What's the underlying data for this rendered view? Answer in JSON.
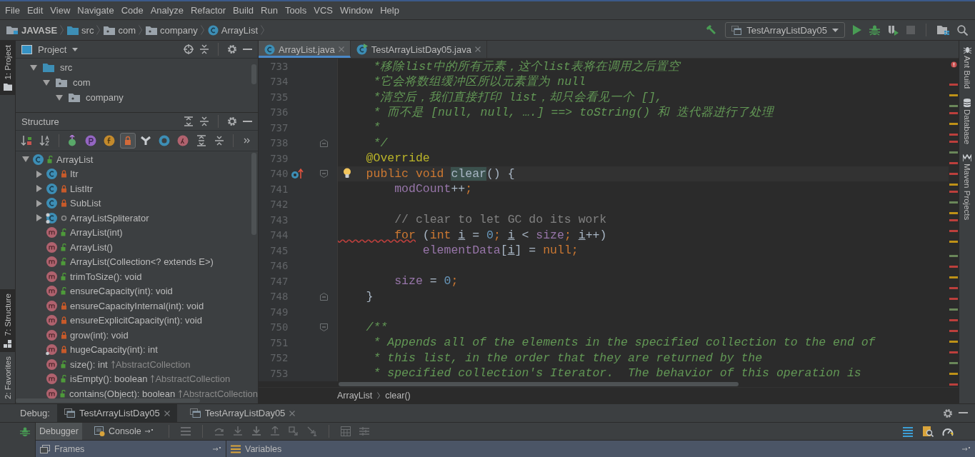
{
  "menu": [
    "File",
    "Edit",
    "View",
    "Navigate",
    "Code",
    "Analyze",
    "Refactor",
    "Build",
    "Run",
    "Tools",
    "VCS",
    "Window",
    "Help"
  ],
  "breadcrumbs": [
    {
      "label": "JAVASE",
      "kind": "project"
    },
    {
      "label": "src",
      "kind": "source-folder"
    },
    {
      "label": "com",
      "kind": "package"
    },
    {
      "label": "company",
      "kind": "package"
    },
    {
      "label": "ArrayList",
      "kind": "class"
    }
  ],
  "run_config": "TestArrayListDay05",
  "left_stripe": [
    {
      "label": "1: Project",
      "selected": true
    },
    {
      "label": "7: Structure",
      "selected": true
    },
    {
      "label": "2: Favorites",
      "selected": false
    }
  ],
  "right_stripe": [
    "Ant Build",
    "Database",
    "Maven Projects"
  ],
  "project_panel": {
    "title": "Project",
    "tree": [
      {
        "label": "src",
        "kind": "source-folder",
        "expanded": true,
        "children": [
          {
            "label": "com",
            "kind": "package",
            "expanded": true,
            "children": [
              {
                "label": "company",
                "kind": "package",
                "expanded": true
              }
            ]
          }
        ]
      }
    ]
  },
  "structure_panel": {
    "title": "Structure",
    "toolbar": [
      {
        "kind": "sort-visibility",
        "selected": false
      },
      {
        "kind": "sort-alpha",
        "selected": false
      },
      {
        "kind": "inherited",
        "selected": false
      },
      {
        "kind": "properties",
        "selected": false
      },
      {
        "kind": "fields",
        "selected": false
      },
      {
        "kind": "non-public",
        "selected": true
      },
      {
        "kind": "anonymous",
        "selected": false
      },
      {
        "kind": "ring",
        "selected": false
      },
      {
        "kind": "lambdas",
        "selected": false
      },
      {
        "kind": "expand-all",
        "selected": false
      },
      {
        "kind": "collapse-all",
        "selected": false
      },
      {
        "kind": "more",
        "selected": false
      }
    ],
    "tree": [
      {
        "label": "ArrayList",
        "kind": "public-class",
        "expanded": true,
        "children": [
          {
            "label": "Itr",
            "kind": "private-class",
            "expanded": false
          },
          {
            "label": "ListItr",
            "kind": "private-class",
            "expanded": false
          },
          {
            "label": "SubList",
            "kind": "private-class",
            "expanded": false
          },
          {
            "label": "ArrayListSpliterator",
            "kind": "package-static-class",
            "expanded": false
          },
          {
            "label": "ArrayList(int)",
            "kind": "public-method"
          },
          {
            "label": "ArrayList()",
            "kind": "public-method"
          },
          {
            "label": "ArrayList(Collection<? extends E>)",
            "kind": "public-method"
          },
          {
            "label": "trimToSize(): void",
            "kind": "public-method"
          },
          {
            "label": "ensureCapacity(int): void",
            "kind": "public-method"
          },
          {
            "label": "ensureCapacityInternal(int): void",
            "kind": "private-method"
          },
          {
            "label": "ensureExplicitCapacity(int): void",
            "kind": "private-method"
          },
          {
            "label": "grow(int): void",
            "kind": "private-method"
          },
          {
            "label": "hugeCapacity(int): int",
            "kind": "private-static-method"
          },
          {
            "label": "size(): int",
            "inherited": "AbstractCollection",
            "kind": "public-method"
          },
          {
            "label": "isEmpty(): boolean",
            "inherited": "AbstractCollection",
            "kind": "public-method"
          },
          {
            "label": "contains(Object): boolean",
            "inherited": "AbstractCollection",
            "kind": "public-method"
          }
        ]
      }
    ]
  },
  "editor": {
    "tabs": [
      {
        "label": "ArrayList.java",
        "kind": "class",
        "selected": true
      },
      {
        "label": "TestArrayListDay05.java",
        "kind": "runnable-class",
        "selected": false
      }
    ],
    "lines": [
      {
        "number": "733",
        "tokens": [
          {
            "kind": "doc",
            "text": "     *移除list中的所有元素，这个list表将在调用之后置空"
          }
        ]
      },
      {
        "number": "734",
        "tokens": [
          {
            "kind": "doc",
            "text": "     *它会将数组缓冲区所以元素置为 null"
          }
        ]
      },
      {
        "number": "735",
        "tokens": [
          {
            "kind": "doc",
            "text": "     *清空后，我们直接打印 list，却只会看见一个 [],"
          }
        ]
      },
      {
        "number": "736",
        "tokens": [
          {
            "kind": "doc",
            "text": "     * 而不是 [null, null, ….] ==> toString() 和 迭代器进行了处理"
          }
        ]
      },
      {
        "number": "737",
        "tokens": [
          {
            "kind": "doc",
            "text": "     *"
          }
        ]
      },
      {
        "number": "738",
        "markers": [
          {
            "kind": "fold-end"
          }
        ],
        "tokens": [
          {
            "kind": "doc",
            "text": "     */"
          }
        ]
      },
      {
        "number": "739",
        "tokens": [
          {
            "kind": "annotation",
            "text": "    @Override"
          }
        ]
      },
      {
        "number": "740",
        "current": true,
        "bulb": true,
        "markers": [
          {
            "kind": "overrides"
          },
          {
            "kind": "fold-start"
          }
        ],
        "tokens": [
          {
            "kind": "keyword",
            "text": "    public void "
          },
          {
            "kind": "method-match",
            "text": "clear"
          },
          {
            "kind": "plain",
            "text": "() {"
          }
        ]
      },
      {
        "number": "741",
        "tokens": [
          {
            "kind": "field",
            "text": "        modCount"
          },
          {
            "kind": "plain",
            "text": "++"
          },
          {
            "kind": "keyword",
            "text": ";"
          }
        ]
      },
      {
        "number": "742"
      },
      {
        "number": "743",
        "tokens": [
          {
            "kind": "comment",
            "text": "        // clear to let GC do its work"
          }
        ]
      },
      {
        "number": "744",
        "tokens": [
          {
            "kind": "keyword-flagged",
            "text": "        for"
          },
          {
            "kind": "plain",
            "text": " ("
          },
          {
            "kind": "keyword",
            "text": "int "
          },
          {
            "kind": "local",
            "text": "i"
          },
          {
            "kind": "plain",
            "text": " = "
          },
          {
            "kind": "number",
            "text": "0"
          },
          {
            "kind": "keyword",
            "text": "; "
          },
          {
            "kind": "local",
            "text": "i"
          },
          {
            "kind": "plain",
            "text": " < "
          },
          {
            "kind": "field",
            "text": "size"
          },
          {
            "kind": "keyword",
            "text": "; "
          },
          {
            "kind": "local",
            "text": "i"
          },
          {
            "kind": "plain",
            "text": "++)"
          }
        ]
      },
      {
        "number": "745",
        "tokens": [
          {
            "kind": "field",
            "text": "            elementData"
          },
          {
            "kind": "plain",
            "text": "["
          },
          {
            "kind": "local",
            "text": "i"
          },
          {
            "kind": "plain",
            "text": "] = "
          },
          {
            "kind": "keyword",
            "text": "null;"
          }
        ]
      },
      {
        "number": "746"
      },
      {
        "number": "747",
        "tokens": [
          {
            "kind": "field",
            "text": "        size"
          },
          {
            "kind": "plain",
            "text": " = "
          },
          {
            "kind": "number",
            "text": "0"
          },
          {
            "kind": "keyword",
            "text": ";"
          }
        ]
      },
      {
        "number": "748",
        "markers": [
          {
            "kind": "fold-end"
          }
        ],
        "tokens": [
          {
            "kind": "plain",
            "text": "    }"
          }
        ]
      },
      {
        "number": "749"
      },
      {
        "number": "750",
        "markers": [
          {
            "kind": "fold-start"
          }
        ],
        "tokens": [
          {
            "kind": "doc",
            "text": "    /**"
          }
        ]
      },
      {
        "number": "751",
        "tokens": [
          {
            "kind": "doc",
            "text": "     * Appends all of the elements in the specified collection to the end of"
          }
        ]
      },
      {
        "number": "752",
        "tokens": [
          {
            "kind": "doc",
            "text": "     * this list, in the order that they are returned by the"
          }
        ]
      },
      {
        "number": "753",
        "tokens": [
          {
            "kind": "doc",
            "text": "     * specified collection's Iterator.  The behavior of this operation is"
          }
        ]
      }
    ],
    "breadcrumb": [
      "ArrayList",
      "clear()"
    ]
  },
  "debug": {
    "title": "Debug:",
    "tabs": [
      {
        "label": "TestArrayListDay05",
        "selected": true
      },
      {
        "label": "TestArrayListDay05",
        "selected": false
      }
    ],
    "sub_tabs": [
      {
        "label": "Debugger",
        "kind": "debugger",
        "selected": true
      },
      {
        "label": "Console",
        "kind": "console",
        "selected": false
      }
    ],
    "panes": [
      "Frames",
      "Variables"
    ]
  }
}
